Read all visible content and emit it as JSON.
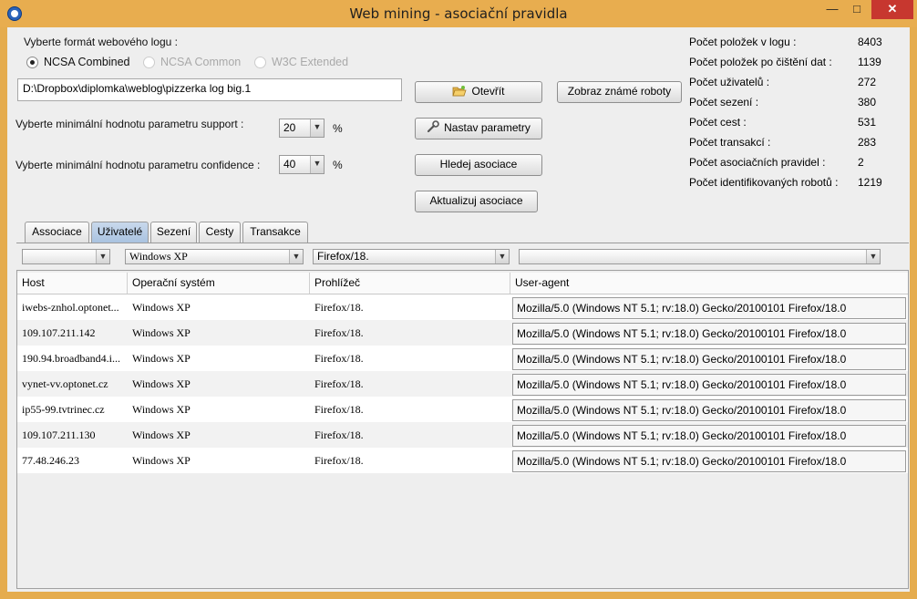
{
  "window": {
    "title": "Web mining - asociační pravidla",
    "icon": "app-globe-icon",
    "controls": {
      "minimize": "—",
      "maximize": "□",
      "close": "✕"
    }
  },
  "form": {
    "log_format_label": "Vyberte formát webového logu :",
    "formats": [
      {
        "label": "NCSA Combined",
        "checked": true,
        "enabled": true
      },
      {
        "label": "NCSA Common",
        "checked": false,
        "enabled": false
      },
      {
        "label": "W3C Extended",
        "checked": false,
        "enabled": false
      }
    ],
    "file_path": "D:\\Dropbox\\diplomka\\weblog\\pizzerka log big.1",
    "support_label": "Vyberte minimální hodnotu parametru support :",
    "support_value": "20",
    "confidence_label": "Vyberte minimální hodnotu parametru confidence :",
    "confidence_value": "40",
    "percent": "%"
  },
  "buttons": {
    "open": "Otevřít",
    "show_robots": "Zobraz známé roboty",
    "set_params": "Nastav parametry",
    "find_assoc": "Hledej asociace",
    "update_assoc": "Aktualizuj asociace"
  },
  "stats": [
    {
      "label": "Počet položek v logu :",
      "value": "8403"
    },
    {
      "label": "Počet položek po čištění dat :",
      "value": "1139"
    },
    {
      "label": "Počet uživatelů :",
      "value": "272"
    },
    {
      "label": "Počet sezení :",
      "value": "380"
    },
    {
      "label": "Počet cest :",
      "value": "531"
    },
    {
      "label": "Počet transakcí :",
      "value": "283"
    },
    {
      "label": "Počet asociačních pravidel :",
      "value": "2"
    },
    {
      "label": "Počet identifikovaných robotů :",
      "value": "1219"
    }
  ],
  "tabs": [
    {
      "label": "Associace",
      "active": false
    },
    {
      "label": "Uživatelé",
      "active": true
    },
    {
      "label": "Sezení",
      "active": false
    },
    {
      "label": "Cesty",
      "active": false
    },
    {
      "label": "Transakce",
      "active": false
    }
  ],
  "filters": {
    "host": "",
    "os": "Windows XP",
    "browser": "Firefox/18.",
    "user_agent": ""
  },
  "table": {
    "columns": [
      "Host",
      "Operační systém",
      "Prohlížeč",
      "User-agent"
    ],
    "rows": [
      [
        "iwebs-znhol.optonet...",
        "Windows XP",
        "Firefox/18.",
        "Mozilla/5.0 (Windows NT 5.1; rv:18.0) Gecko/20100101 Firefox/18.0"
      ],
      [
        "109.107.211.142",
        "Windows XP",
        "Firefox/18.",
        "Mozilla/5.0 (Windows NT 5.1; rv:18.0) Gecko/20100101 Firefox/18.0"
      ],
      [
        "190.94.broadband4.i...",
        "Windows XP",
        "Firefox/18.",
        "Mozilla/5.0 (Windows NT 5.1; rv:18.0) Gecko/20100101 Firefox/18.0"
      ],
      [
        "vynet-vv.optonet.cz",
        "Windows XP",
        "Firefox/18.",
        "Mozilla/5.0 (Windows NT 5.1; rv:18.0) Gecko/20100101 Firefox/18.0"
      ],
      [
        "ip55-99.tvtrinec.cz",
        "Windows XP",
        "Firefox/18.",
        "Mozilla/5.0 (Windows NT 5.1; rv:18.0) Gecko/20100101 Firefox/18.0"
      ],
      [
        "109.107.211.130",
        "Windows XP",
        "Firefox/18.",
        "Mozilla/5.0 (Windows NT 5.1; rv:18.0) Gecko/20100101 Firefox/18.0"
      ],
      [
        "77.48.246.23",
        "Windows XP",
        "Firefox/18.",
        "Mozilla/5.0 (Windows NT 5.1; rv:18.0) Gecko/20100101 Firefox/18.0"
      ]
    ]
  }
}
